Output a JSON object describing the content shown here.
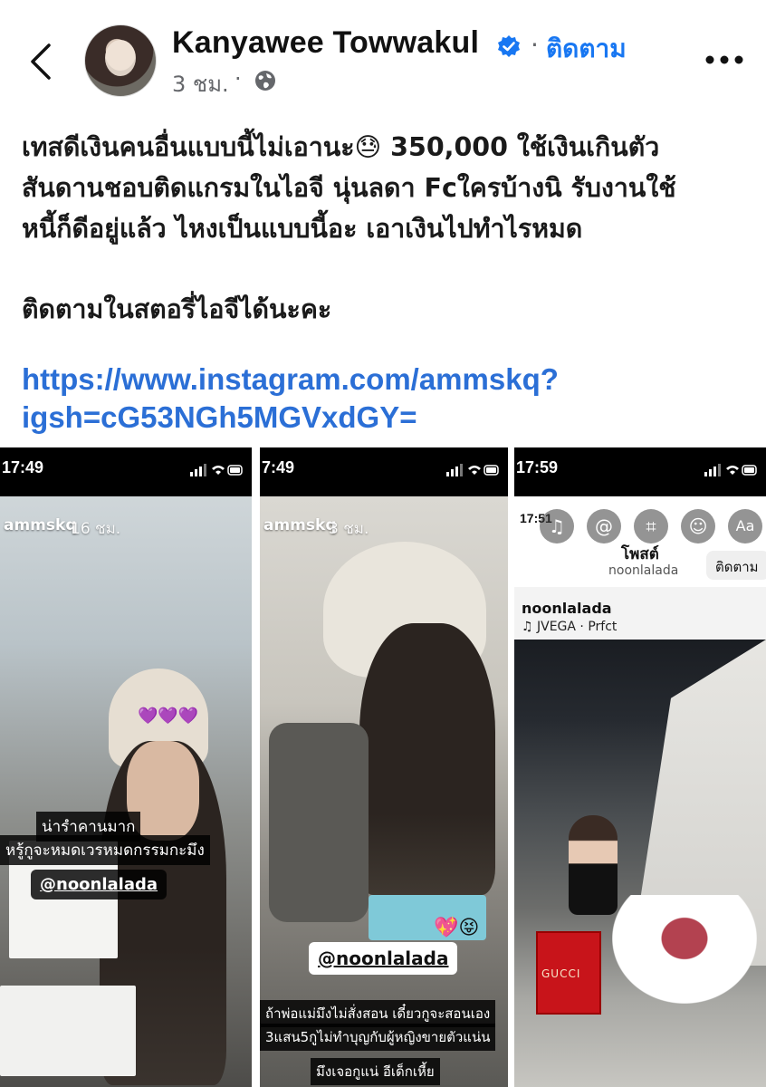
{
  "header": {
    "back_icon": "chevron-left-icon",
    "author_name": "Kanyawee Towwakul",
    "verified_icon": "verified-badge-icon",
    "separator": "·",
    "follow_label": "ติดตาม",
    "time_ago": "3 ชม.",
    "meta_separator": "·",
    "privacy_icon": "globe-icon",
    "more_icon": "more-horizontal-icon"
  },
  "post": {
    "text_lines": [
      "เทสดีเงินคนอื่นแบบนี้ไม่เอานะ😓 350,000 ใช้เงินเกินตัว",
      "สันดานชอบติดแกรมในไอจี นุ่นลดา Fcใครบ้างนิ รับงานใช้",
      "หนี้ก็ดีอยู่แล้ว ไหงเป็นแบบนี้อะ เอาเงินไปทำไรหมด"
    ],
    "follow_story": "ติดตามในสตอรี่ไอจีได้นะคะ",
    "link_lines": [
      "https://www.instagram.com/ammskq?",
      "igsh=cG53NGh5MGVxdGY="
    ]
  },
  "images": [
    {
      "status_time": "17:49",
      "story_user": "ammskq",
      "story_time": "16 ชม.",
      "caption_lines": [
        "น่ารำคานมาก",
        "หรู้กูจะหมดเวรหมดกรรมกะมึง"
      ],
      "mention": "@noonlalada",
      "emoji": "💜💜💜"
    },
    {
      "status_time": "7:49",
      "story_user": "ammskq",
      "story_time": "3 ชม.",
      "mention": "@noonlalada",
      "caption_lines": [
        "ถ้าพ่อแม่มึงไม่สั่งสอน เดี๋ยวกูจะสอนเอง",
        "3แสน5กูไม่ทำบุญกับผู้หญิงขายตัวแน่น"
      ],
      "caption_bottom": "มึงเจอกูแน่ อีเด็กเหี้ย",
      "emoji": "💖😝"
    },
    {
      "status_time": "17:59",
      "inner_time": "17:51",
      "post_title": "โพสต์",
      "post_sub": "noonlalada",
      "follow_label": "ติดตาม",
      "username": "noonlalada",
      "music": "♫ JVEGA · Prfct",
      "bag_brand": "GUCCI",
      "icons": [
        "music-icon",
        "mention-icon",
        "crop-icon",
        "sticker-icon",
        "text-icon"
      ]
    }
  ]
}
